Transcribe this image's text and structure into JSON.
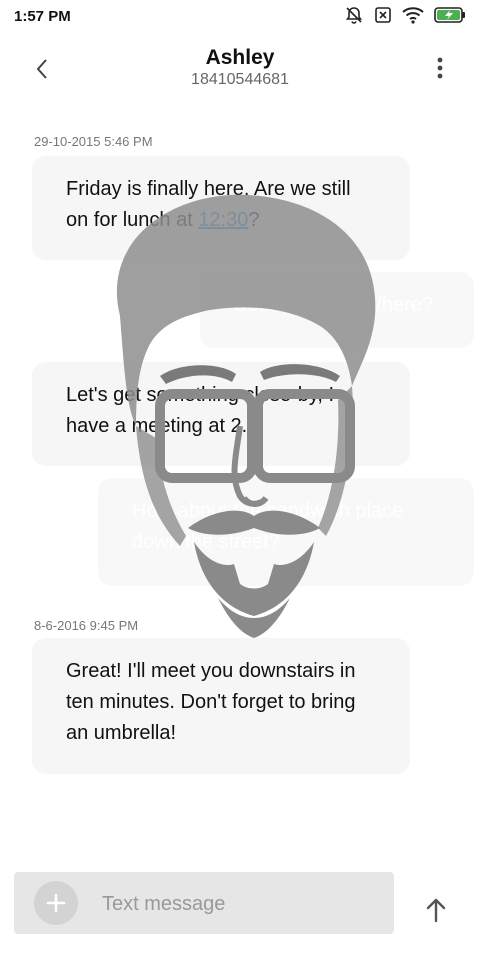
{
  "status_bar": {
    "time": "1:57 PM",
    "icons": [
      "alarm-off-icon",
      "no-sim-icon",
      "wifi-icon",
      "battery-charging-icon"
    ],
    "battery_color": "#4caf50"
  },
  "header": {
    "contact_name": "Ashley",
    "contact_number": "18410544681"
  },
  "messages": [
    {
      "timestamp": "29-10-2015 5:46 PM",
      "direction": "incoming",
      "text_before_link": "Friday is finally here. Are we still on for lunch at ",
      "link_text": "12:30",
      "text_after_link": "?"
    },
    {
      "direction": "outgoing",
      "text": "Sounds good. Where?"
    },
    {
      "direction": "incoming",
      "text": "Let's get something close-by, I have a meeting at 2."
    },
    {
      "direction": "outgoing",
      "text": "How about the sandwich place down the street?"
    },
    {
      "timestamp": "8-6-2016 9:45 PM",
      "direction": "incoming",
      "text": "Great! I'll meet you downstairs in ten minutes. Don't forget to bring an umbrella!"
    }
  ],
  "composer": {
    "placeholder": "Text message"
  },
  "colors": {
    "link": "#2b8fe0",
    "bubble": "#f5f5f5",
    "composer": "#e6e6e6"
  }
}
